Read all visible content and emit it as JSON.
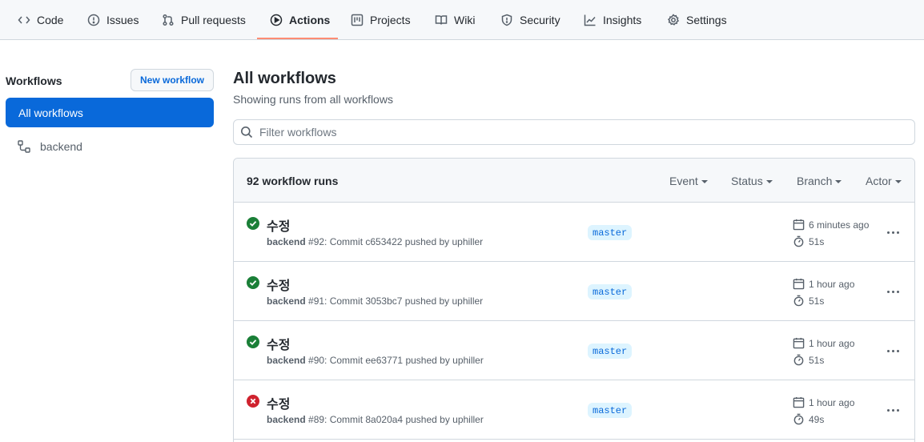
{
  "nav": {
    "tabs": [
      {
        "label": "Code",
        "icon": "code-icon"
      },
      {
        "label": "Issues",
        "icon": "issue-icon"
      },
      {
        "label": "Pull requests",
        "icon": "pull-request-icon"
      },
      {
        "label": "Actions",
        "icon": "play-icon",
        "active": true
      },
      {
        "label": "Projects",
        "icon": "project-icon"
      },
      {
        "label": "Wiki",
        "icon": "book-icon"
      },
      {
        "label": "Security",
        "icon": "shield-icon"
      },
      {
        "label": "Insights",
        "icon": "graph-icon"
      },
      {
        "label": "Settings",
        "icon": "gear-icon"
      }
    ],
    "active_underline_color": "#fd8c73"
  },
  "sidebar": {
    "title": "Workflows",
    "new_workflow_label": "New workflow",
    "items": [
      {
        "label": "All workflows",
        "selected": true
      },
      {
        "label": "backend",
        "icon": "workflow-icon"
      }
    ]
  },
  "main": {
    "title": "All workflows",
    "subtitle": "Showing runs from all workflows",
    "filter_placeholder": "Filter workflows",
    "runs_count": "92 workflow runs",
    "filters": [
      "Event",
      "Status",
      "Branch",
      "Actor"
    ],
    "runs": [
      {
        "status": "success",
        "title": "수정",
        "workflow": "backend",
        "meta": "#92: Commit c653422 pushed by uphiller",
        "branch": "master",
        "time": "6 minutes ago",
        "duration": "51s"
      },
      {
        "status": "success",
        "title": "수정",
        "workflow": "backend",
        "meta": "#91: Commit 3053bc7 pushed by uphiller",
        "branch": "master",
        "time": "1 hour ago",
        "duration": "51s"
      },
      {
        "status": "success",
        "title": "수정",
        "workflow": "backend",
        "meta": "#90: Commit ee63771 pushed by uphiller",
        "branch": "master",
        "time": "1 hour ago",
        "duration": "51s"
      },
      {
        "status": "failure",
        "title": "수정",
        "workflow": "backend",
        "meta": "#89: Commit 8a020a4 pushed by uphiller",
        "branch": "master",
        "time": "1 hour ago",
        "duration": "49s"
      }
    ]
  },
  "colors": {
    "accent": "#0969da",
    "success": "#1a7f37",
    "failure": "#cf222e",
    "branch_bg": "#ddf4ff"
  }
}
